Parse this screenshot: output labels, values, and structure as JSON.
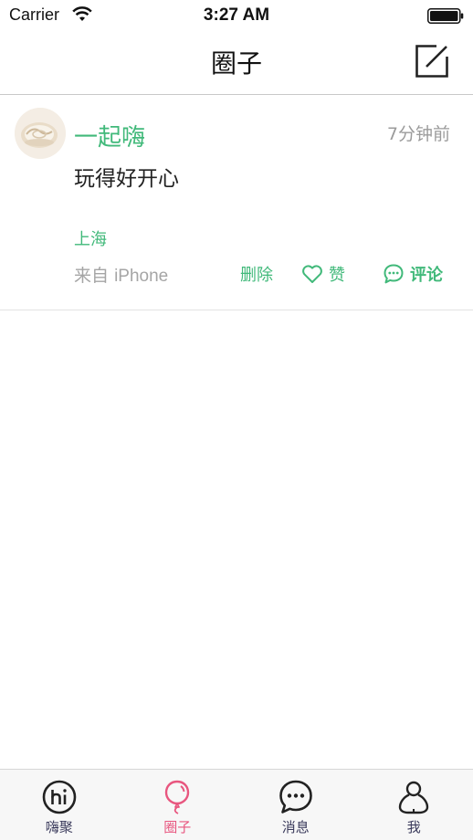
{
  "status_bar": {
    "carrier": "Carrier",
    "time": "3:27 AM"
  },
  "nav": {
    "title": "圈子",
    "compose_icon": "compose-icon"
  },
  "post": {
    "username": "一起嗨",
    "time_ago": "7分钟前",
    "content": "玩得好开心",
    "location": "上海",
    "source_prefix": "来自",
    "source_device": "iPhone",
    "delete_label": "删除",
    "like_label": "赞",
    "comment_label": "评论"
  },
  "tab_bar": {
    "active_tab": "圈子",
    "active_color": "#e8567f",
    "inactive_color": "#3b3b5c",
    "tabs": [
      {
        "label": "嗨聚",
        "icon": "hi-icon"
      },
      {
        "label": "圈子",
        "icon": "balloon-icon"
      },
      {
        "label": "消息",
        "icon": "chat-bubble-icon"
      },
      {
        "label": "我",
        "icon": "person-icon"
      }
    ]
  },
  "colors": {
    "accent": "#41b97a",
    "muted_text": "#9b9b9b"
  }
}
